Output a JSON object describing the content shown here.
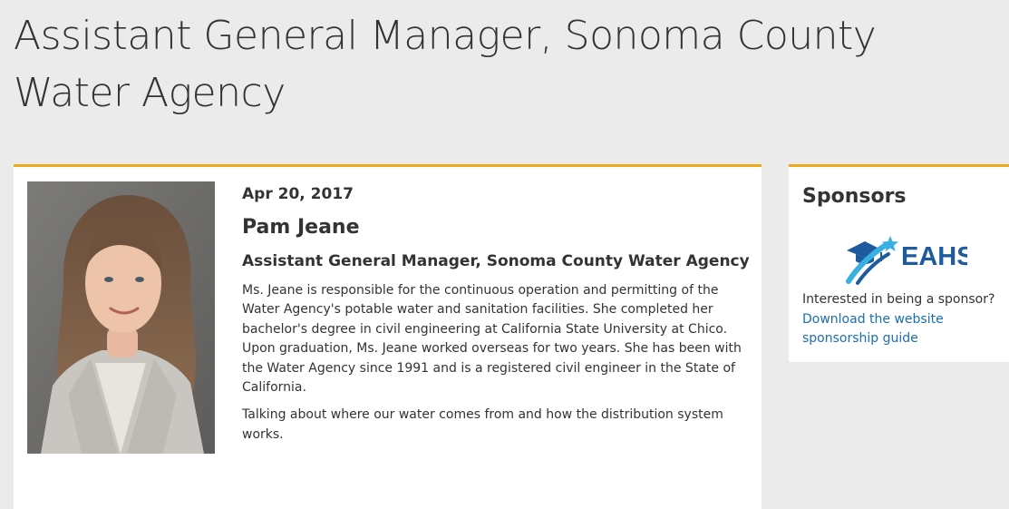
{
  "page": {
    "title": "Assistant General Manager, Sonoma County Water Agency"
  },
  "speaker": {
    "date": "Apr 20, 2017",
    "name": "Pam Jeane",
    "role": "Assistant General Manager, Sonoma County Water Agency",
    "bio": "Ms. Jeane is responsible for the continuous operation and permitting of the Water Agency's potable water and sanitation facilities. She completed her bachelor's degree in civil engineering at California State University at Chico. Upon graduation, Ms. Jeane worked overseas for two years. She has been with the Water Agency since 1991 and is a registered civil engineer in the State of California.",
    "talk": "Talking about where our water comes from and how the distribution system works."
  },
  "sidebar": {
    "title": "Sponsors",
    "logo_text": "EAHS",
    "prompt": "Interested in being a sponsor?",
    "link_label": "Download the website sponsorship guide"
  },
  "colors": {
    "accent": "#f0a818",
    "link": "#1a6fb0",
    "background": "#ebebeb",
    "logo_dark": "#1d5a9e",
    "logo_light": "#3ab0e2"
  }
}
